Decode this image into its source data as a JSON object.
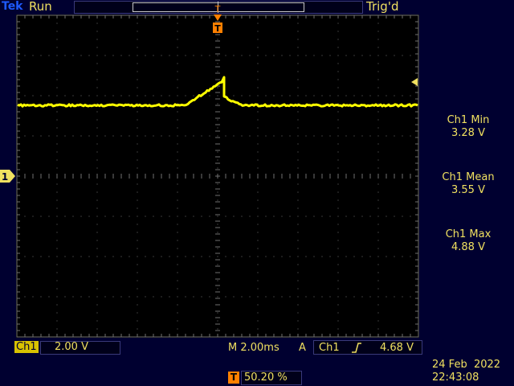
{
  "header": {
    "brand": "Tek",
    "run_state": "Run",
    "trigger_status": "Trig'd"
  },
  "measurements": [
    {
      "label": "Ch1 Min",
      "value": "3.28 V"
    },
    {
      "label": "Ch1 Mean",
      "value": "3.55 V"
    },
    {
      "label": "Ch1 Max",
      "value": "4.88 V"
    }
  ],
  "footer": {
    "channel_chip": "Ch1",
    "volts_per_div": "2.00 V",
    "timebase": "M 2.00ms",
    "trigger_mode": "A",
    "trigger_source": "Ch1",
    "trigger_slope_icon": "rising-edge-icon",
    "trigger_level": "4.68 V",
    "trigger_position_icon": "T",
    "trigger_position": "50.20 %",
    "date": "24 Feb  2022",
    "time": "22:43:08"
  },
  "markers": {
    "channel_marker": "1",
    "trigger_marker": "T"
  },
  "colors": {
    "trace": "#ffff00",
    "text": "#f0e060",
    "brand": "#1e5aff",
    "trigger_marker": "#ff8000",
    "background": "#000030"
  }
}
